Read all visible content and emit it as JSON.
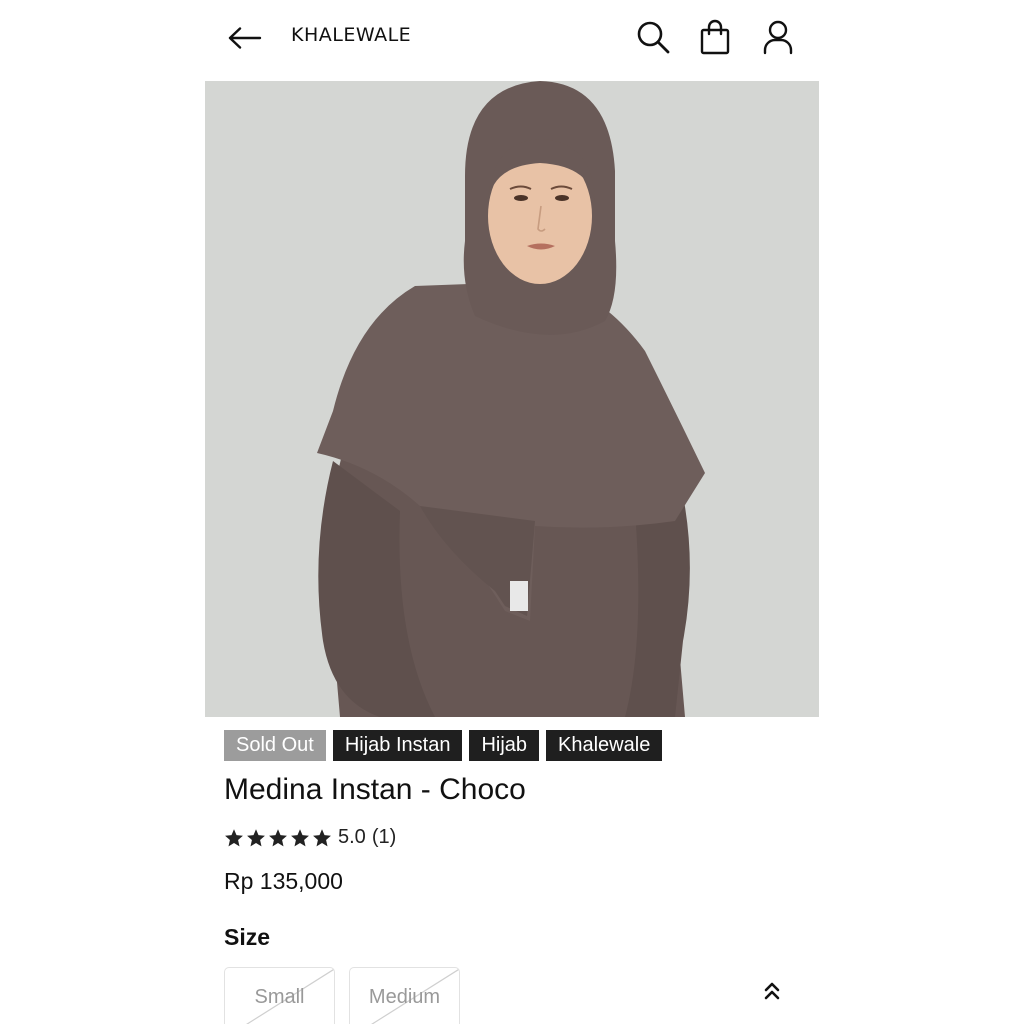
{
  "header": {
    "brand": "KHALEWALE",
    "icons": [
      "arrow-left-icon",
      "search-icon",
      "shopping-bag-icon",
      "user-icon"
    ]
  },
  "product": {
    "tags": [
      {
        "label": "Sold Out",
        "color": "#9c9c9c"
      },
      {
        "label": "Hijab Instan",
        "color": "#1f1f1f"
      },
      {
        "label": "Hijab",
        "color": "#1f1f1f"
      },
      {
        "label": "Khalewale",
        "color": "#1f1f1f"
      }
    ],
    "title": "Medina Instan - Choco",
    "rating": {
      "stars": 5,
      "score": "5.0",
      "count": "(1)"
    },
    "price": "Rp 135,000",
    "size_label": "Size",
    "sizes": [
      {
        "label": "Small",
        "available": false
      },
      {
        "label": "Medium",
        "available": false
      }
    ]
  },
  "colors": {
    "garment": "#6b5b58",
    "backdrop": "#d4d6d3",
    "star": "#222222"
  }
}
